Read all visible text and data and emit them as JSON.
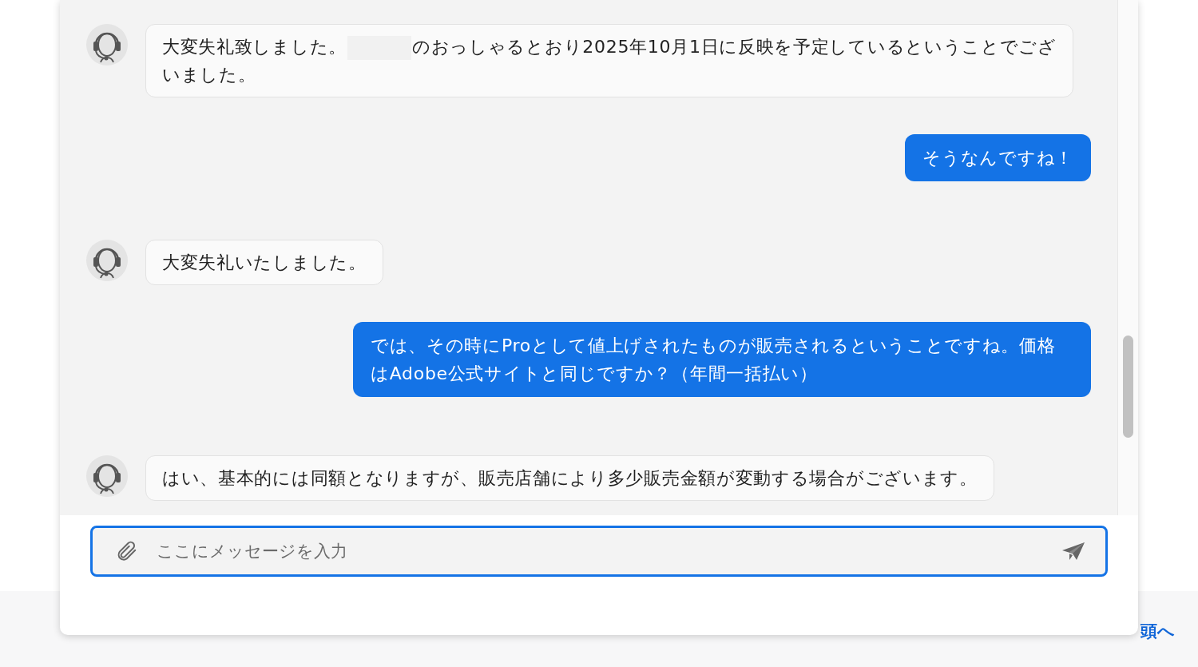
{
  "messages": [
    {
      "kind": "agent",
      "parts": [
        {
          "kind": "text",
          "text": "大変失礼致しました。"
        },
        {
          "kind": "redacted"
        },
        {
          "kind": "text",
          "text": "のおっしゃるとおり2025年10月1日に反映を予定しているということでございました。"
        }
      ]
    },
    {
      "kind": "user",
      "parts": [
        {
          "kind": "text",
          "text": "そうなんですね！"
        }
      ]
    },
    {
      "kind": "agent",
      "parts": [
        {
          "kind": "text",
          "text": "大変失礼いたしました。"
        }
      ]
    },
    {
      "kind": "user",
      "parts": [
        {
          "kind": "text",
          "text": "では、その時にProとして値上げされたものが販売されるということですね。価格はAdobe公式サイトと同じですか？（年間一括払い）"
        }
      ]
    },
    {
      "kind": "agent",
      "parts": [
        {
          "kind": "text",
          "text": "はい、基本的には同額となりますが、販売店舗により多少販売金額が変動する場合がございます。"
        }
      ]
    }
  ],
  "composer": {
    "placeholder": "ここにメッセージを入力"
  },
  "footer_link": "頭へ"
}
